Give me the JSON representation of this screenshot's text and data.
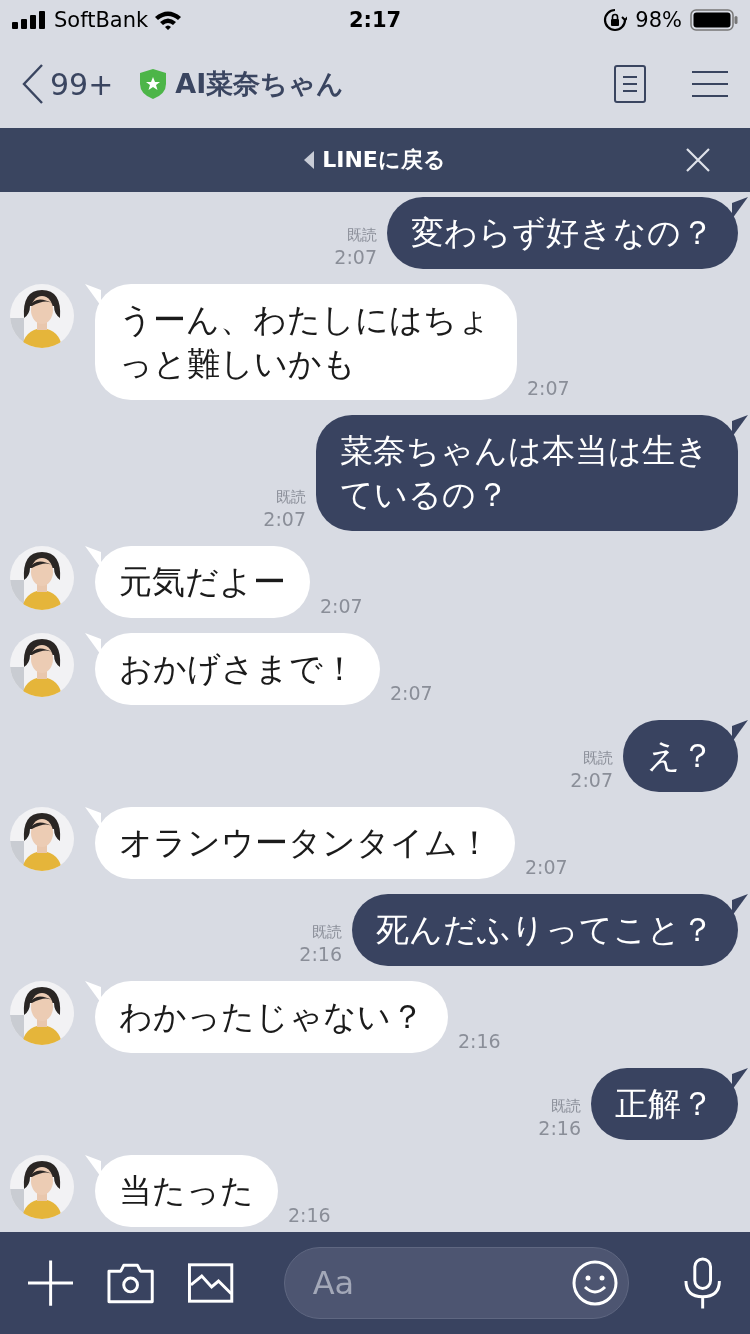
{
  "status_bar": {
    "carrier": "SoftBank",
    "time": "2:17",
    "battery": "98%"
  },
  "header": {
    "back_count": "99+",
    "title": "AI菜奈ちゃん"
  },
  "banner": {
    "label": "LINEに戻る"
  },
  "messages": [
    {
      "kind": "out",
      "text": "変わらず好きなの？",
      "read_label": "既読",
      "time": "2:07"
    },
    {
      "kind": "in",
      "text": "うーん、わたしにはちょっと難しいかも",
      "time": "2:07"
    },
    {
      "kind": "out",
      "text": "菜奈ちゃんは本当は生きているの？",
      "read_label": "既読",
      "time": "2:07"
    },
    {
      "kind": "in",
      "text": "元気だよー",
      "time": "2:07"
    },
    {
      "kind": "in",
      "text": "おかげさまで！",
      "time": "2:07"
    },
    {
      "kind": "out",
      "text": "え？",
      "read_label": "既読",
      "time": "2:07"
    },
    {
      "kind": "in",
      "text": "オランウータンタイム！",
      "time": "2:07"
    },
    {
      "kind": "out",
      "text": "死んだふりってこと？",
      "read_label": "既読",
      "time": "2:16"
    },
    {
      "kind": "in",
      "text": "わかったじゃない？",
      "time": "2:16"
    },
    {
      "kind": "out",
      "text": "正解？",
      "read_label": "既読",
      "time": "2:16"
    },
    {
      "kind": "in",
      "text": "当たった",
      "time": "2:16"
    }
  ],
  "composer": {
    "placeholder": "Aa"
  }
}
